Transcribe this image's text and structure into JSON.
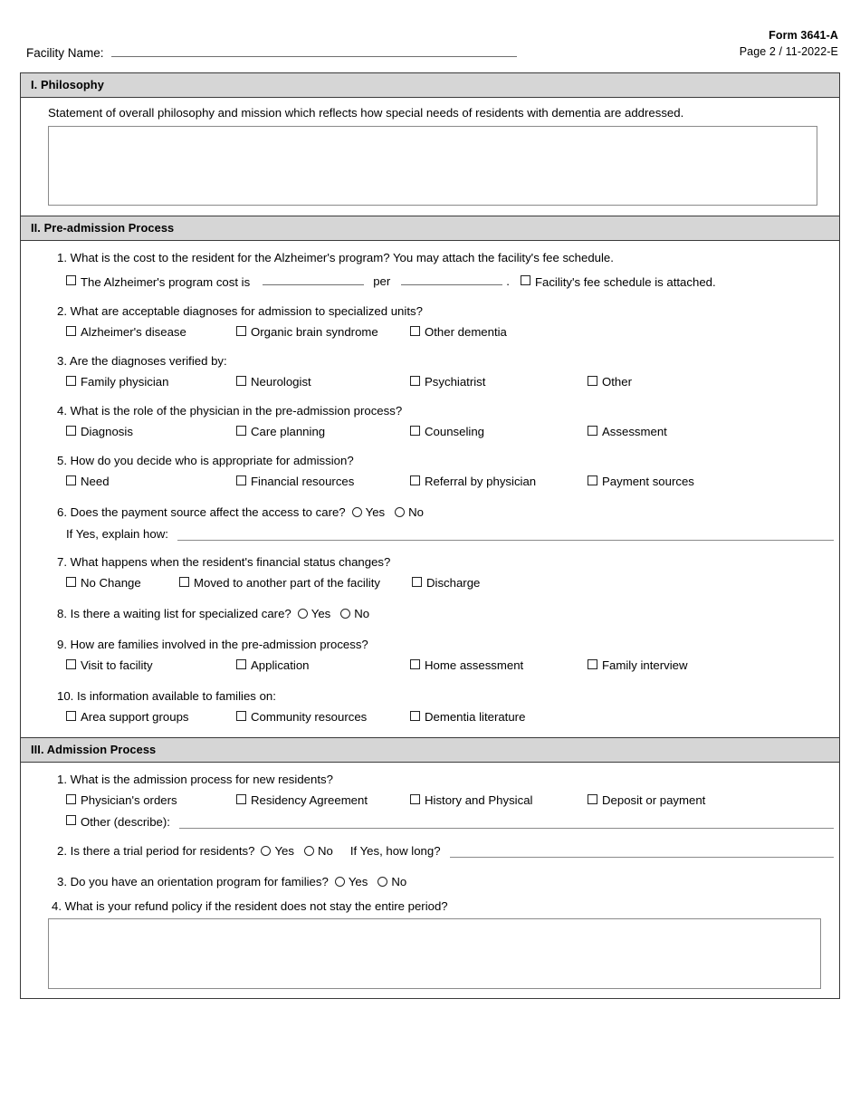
{
  "header": {
    "facility_label": "Facility Name:",
    "form_number": "Form 3641-A",
    "page_info": "Page 2 / 11-2022-E"
  },
  "sections": {
    "philosophy": {
      "heading": "I. Philosophy",
      "note": "Statement of overall philosophy and mission which reflects how special needs of residents with dementia are addressed.",
      "answer": ""
    },
    "preadmission": {
      "heading": "II. Pre-admission Process",
      "q1": {
        "text": "1. What is the cost to the resident for the Alzheimer's program? You may attach the facility's fee schedule.",
        "cost_label": "The Alzheimer's program cost is",
        "per_label": "per",
        "period": ".",
        "fee_schedule_label": "Facility's fee schedule is attached.",
        "cost_value": "",
        "unit_value": ""
      },
      "q2": {
        "text": "2. What are acceptable diagnoses for admission to specialized units?",
        "options": [
          "Alzheimer's disease",
          "Organic brain syndrome",
          "Other dementia"
        ]
      },
      "q3": {
        "text": "3. Are the diagnoses verified by:",
        "options": [
          "Family physician",
          "Neurologist",
          "Psychiatrist",
          "Other"
        ]
      },
      "q4": {
        "text": "4. What is the role of the physician in the pre-admission process?",
        "options": [
          "Diagnosis",
          "Care planning",
          "Counseling",
          "Assessment"
        ]
      },
      "q5": {
        "text": "5. How do you decide who is appropriate for admission?",
        "options": [
          "Need",
          "Financial resources",
          "Referral by physician",
          "Payment sources"
        ]
      },
      "q6": {
        "text": "6. Does the payment source affect the access to care?",
        "yes": "Yes",
        "no": "No",
        "followup": "If Yes, explain how:",
        "followup_value": ""
      },
      "q7": {
        "text": "7. What happens when the resident's financial status changes?",
        "options": [
          "No Change",
          "Moved to another part of the facility",
          "Discharge"
        ]
      },
      "q8": {
        "text": "8. Is there a waiting list for specialized care?",
        "yes": "Yes",
        "no": "No"
      },
      "q9": {
        "text": "9. How are families involved in the pre-admission process?",
        "options": [
          "Visit to facility",
          "Application",
          "Home assessment",
          "Family interview"
        ]
      },
      "q10": {
        "text": "10. Is information available to families on:",
        "options": [
          "Area support groups",
          "Community resources",
          "Dementia literature"
        ]
      }
    },
    "admission": {
      "heading": "III. Admission Process",
      "q1": {
        "text": "1. What is the admission process for new residents?",
        "options": [
          "Physician's orders",
          "Residency Agreement",
          "History and Physical",
          "Deposit or payment"
        ],
        "other_label": "Other (describe):",
        "other_value": ""
      },
      "q2": {
        "text": "2. Is there a trial period for residents?",
        "yes": "Yes",
        "no": "No",
        "followup": "If Yes, how long?",
        "followup_value": ""
      },
      "q3": {
        "text": "3. Do you have an orientation program for families?",
        "yes": "Yes",
        "no": "No"
      },
      "q4": {
        "text": "4. What is your refund policy if the resident does not stay the entire period?",
        "answer": ""
      }
    }
  }
}
